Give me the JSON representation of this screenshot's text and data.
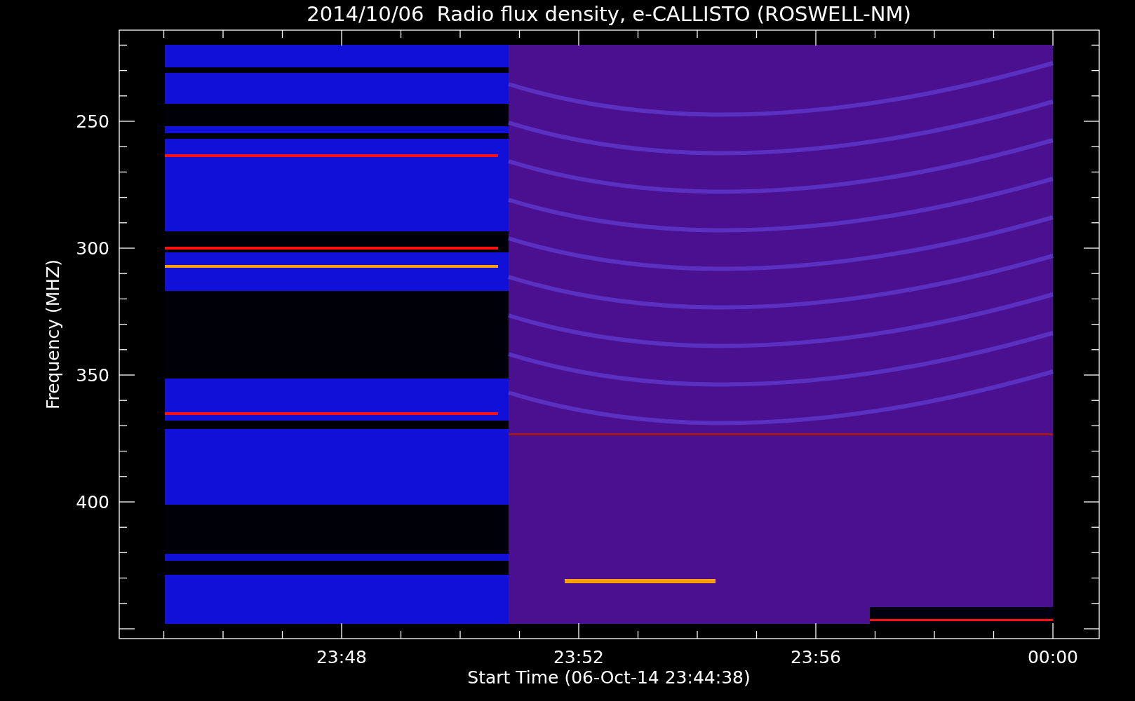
{
  "title": "2014/10/06  Radio flux density, e-CALLISTO (ROSWELL-NM)",
  "y_axis": {
    "label": "Frequency (MHZ)",
    "ticks": [
      "250",
      "300",
      "350",
      "400"
    ]
  },
  "x_axis": {
    "label": "Start Time (06-Oct-14 23:44:38)",
    "ticks": [
      "23:48",
      "23:52",
      "23:56",
      "00:00"
    ]
  }
}
